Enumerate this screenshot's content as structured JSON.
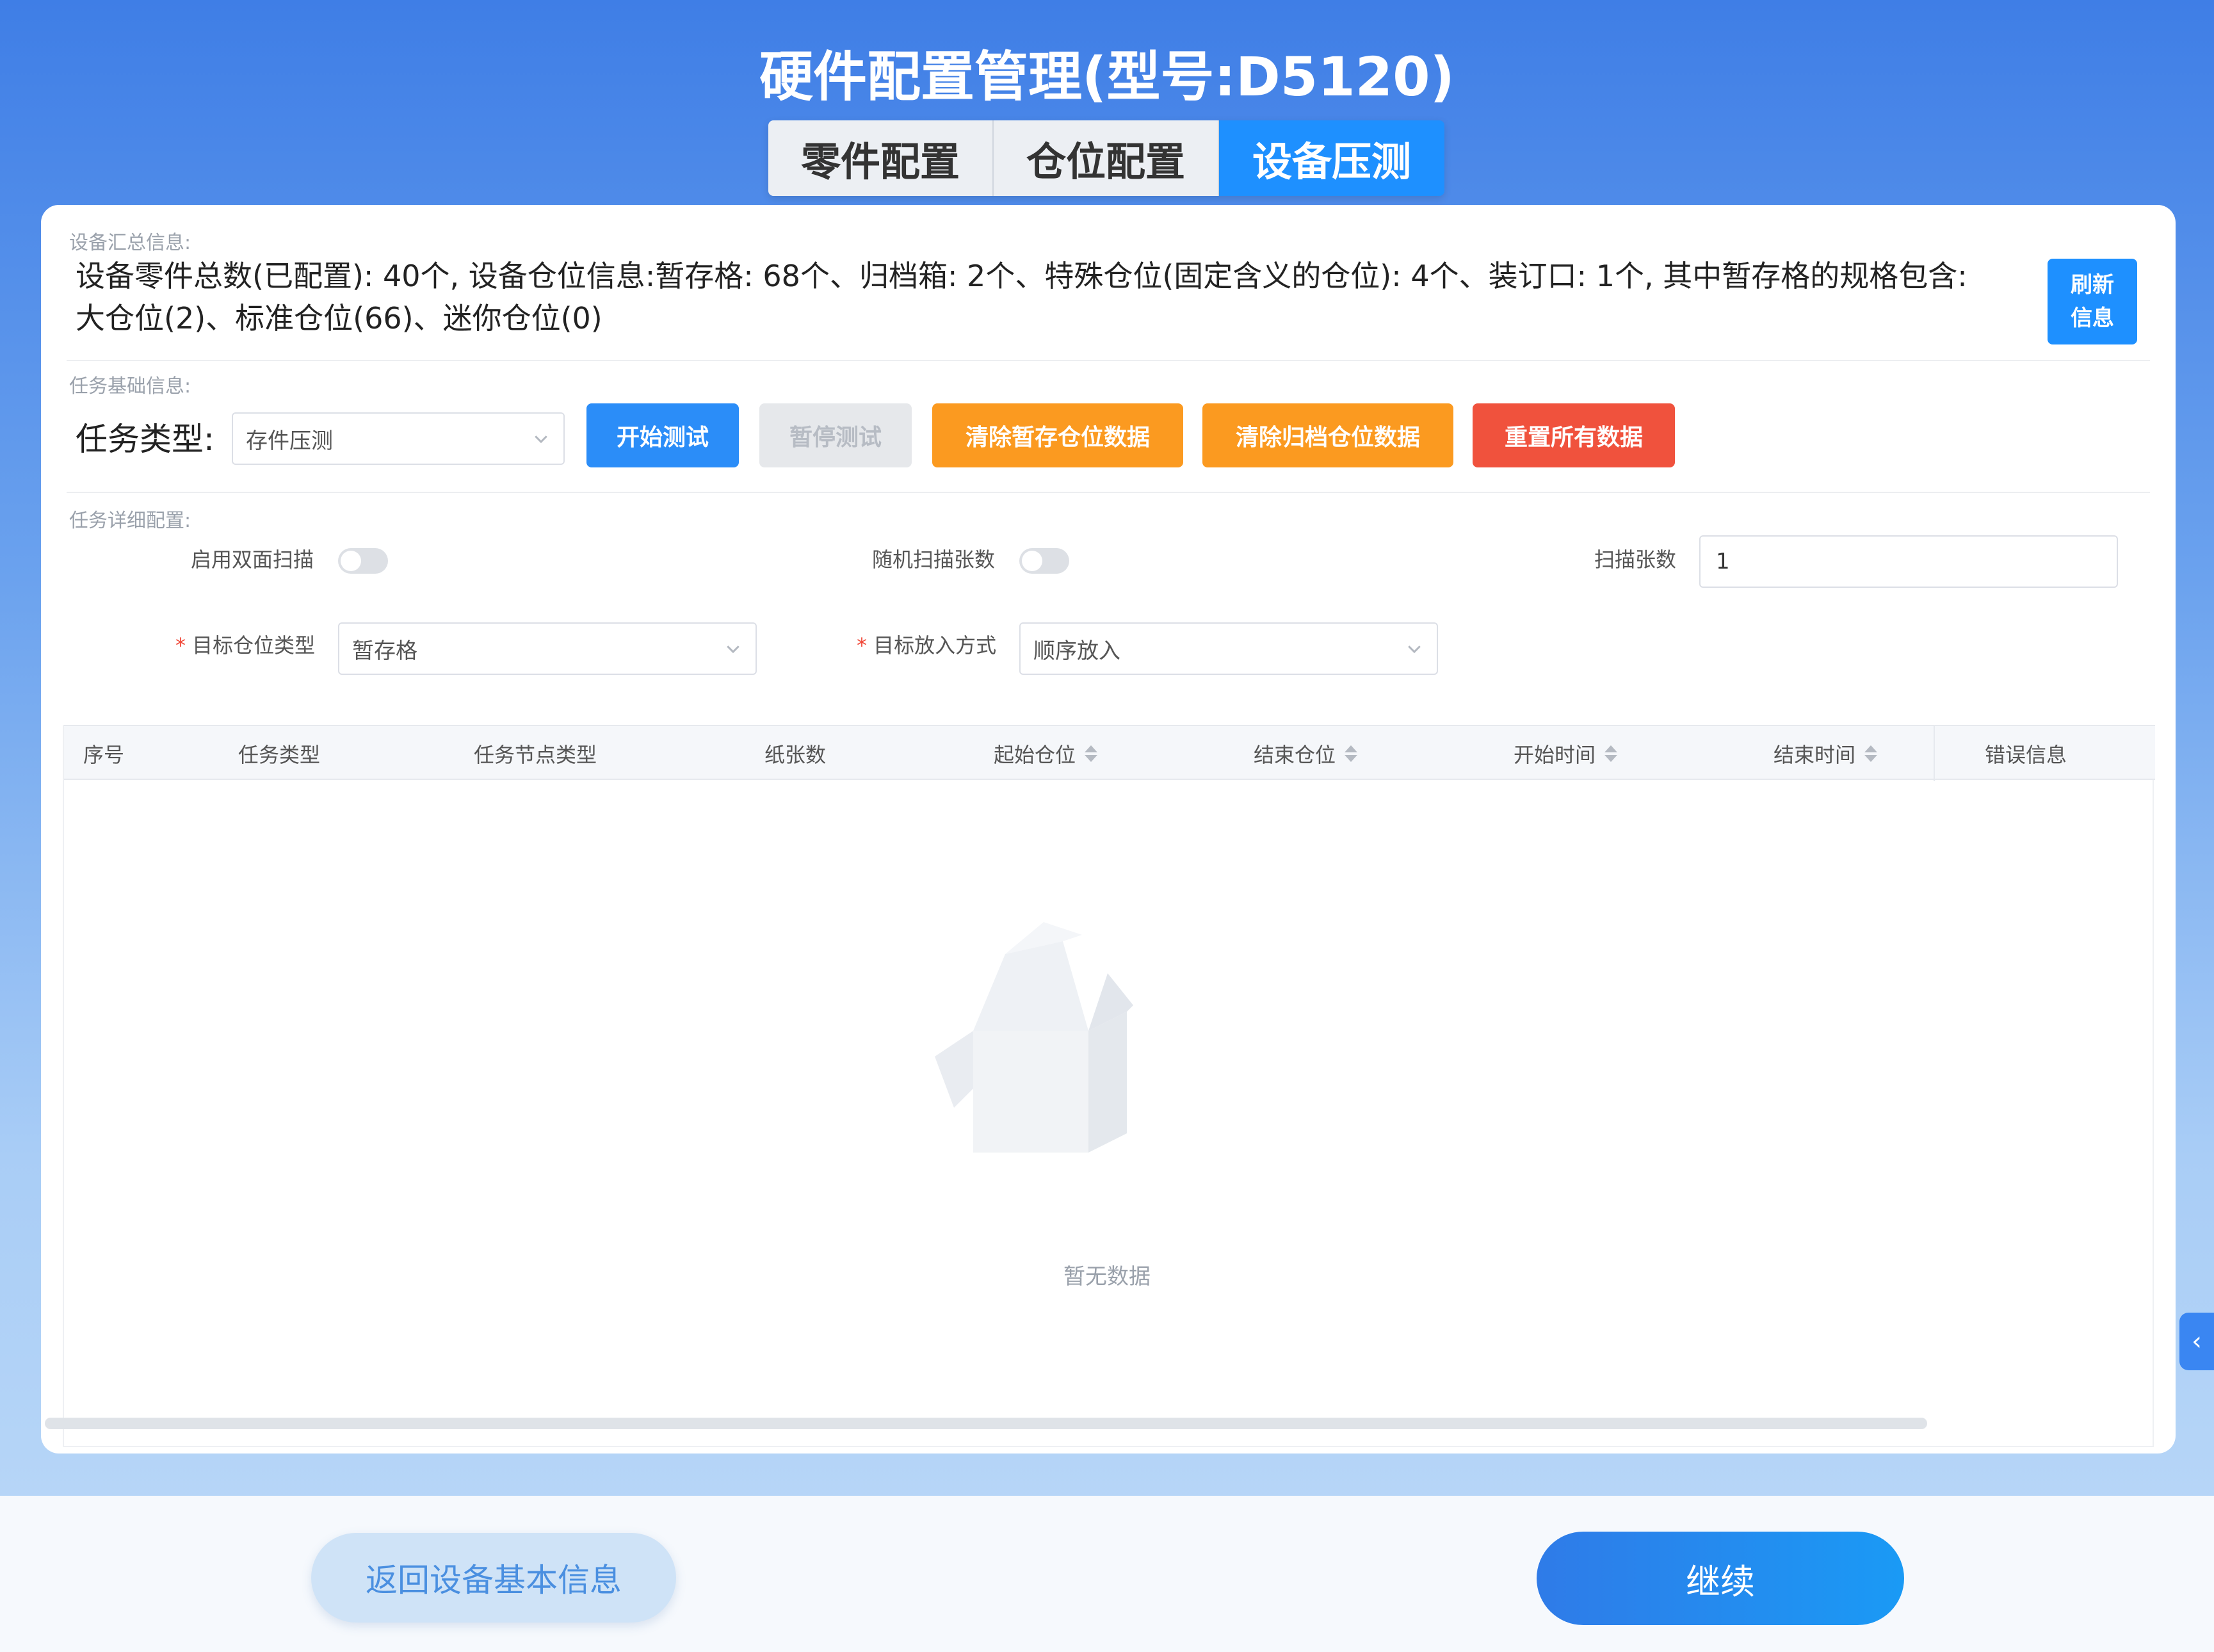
{
  "title": "硬件配置管理(型号:D5120)",
  "tabs": [
    {
      "label": "零件配置",
      "active": false
    },
    {
      "label": "仓位配置",
      "active": false
    },
    {
      "label": "设备压测",
      "active": true
    }
  ],
  "summary": {
    "section_label": "设备汇总信息:",
    "line1": "设备零件总数(已配置): 40个, 设备仓位信息:暂存格: 68个、归档箱: 2个、特殊仓位(固定含义的仓位): 4个、装订口: 1个, 其中暂存格的规格包含:",
    "line2": "大仓位(2)、标准仓位(66)、迷你仓位(0)",
    "refresh_label": "刷新信息"
  },
  "task_basic": {
    "section_label": "任务基础信息:",
    "task_type_label": "任务类型:",
    "task_type_value": "存件压测",
    "buttons": {
      "start": "开始测试",
      "pause": "暂停测试",
      "clear_temp": "清除暂存仓位数据",
      "clear_archive": "清除归档仓位数据",
      "reset_all": "重置所有数据"
    }
  },
  "task_detail": {
    "section_label": "任务详细配置:",
    "duplex_label": "启用双面扫描",
    "duplex_on": false,
    "random_scan_label": "随机扫描张数",
    "random_scan_on": false,
    "scan_count_label": "扫描张数",
    "scan_count_value": "1",
    "required_mark": "*",
    "target_slot_type_label": "目标仓位类型",
    "target_slot_type_value": "暂存格",
    "target_method_label": "目标放入方式",
    "target_method_value": "顺序放入"
  },
  "table": {
    "columns": [
      "序号",
      "任务类型",
      "任务节点类型",
      "纸张数",
      "起始仓位",
      "结束仓位",
      "开始时间",
      "结束时间",
      "错误信息"
    ],
    "sortable": [
      false,
      false,
      false,
      false,
      true,
      true,
      true,
      true,
      false
    ],
    "rows": [],
    "empty_text": "暂无数据"
  },
  "side_tab_icon": "chevron-left-icon",
  "footer": {
    "back_label": "返回设备基本信息",
    "continue_label": "继续"
  },
  "colors": {
    "primary": "#1e90ff",
    "orange": "#fb9a20",
    "red": "#f0523d",
    "disabled": "#e6e8eb"
  }
}
